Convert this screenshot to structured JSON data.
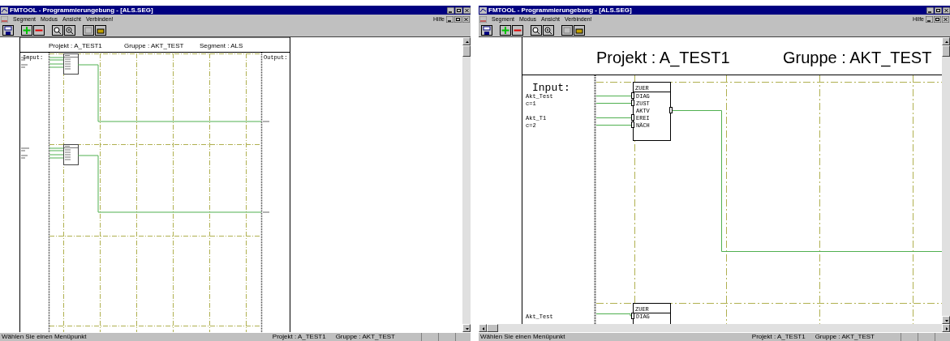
{
  "windows": [
    {
      "kind": "overview",
      "title": "FMTOOL - Programmierungebung - [ALS.SEG]",
      "menu": [
        "Segment",
        "Modus",
        "Ansicht",
        "Verbinden!"
      ],
      "help": "Hilfe",
      "header": [
        "Projekt : A_TEST1",
        "Gruppe : AKT_TEST",
        "Segment : ALS"
      ],
      "input_label": "Input:",
      "output_label": "Output:",
      "status": {
        "message": "Wählen Sie einen Menüpunkt",
        "project": "Projekt : A_TEST1",
        "group": "Gruppe : AKT_TEST"
      }
    },
    {
      "kind": "zoomed",
      "title": "FMTOOL - Programmierungebung - [ALS.SEG]",
      "menu": [
        "Segment",
        "Modus",
        "Ansicht",
        "Verbinden!"
      ],
      "help": "Hilfe",
      "header": [
        "Projekt : A_TEST1",
        "Gruppe : AKT_TEST"
      ],
      "input_label": "Input:",
      "inputs": [
        {
          "name": "Akt_Test",
          "value": "c=1"
        },
        {
          "name": "Akt_T1",
          "value": "c=2"
        },
        {
          "name": "Akt_Test"
        }
      ],
      "blocks": [
        {
          "title": "ZUER",
          "pins": [
            {
              "label": "DIAG",
              "kind": "input"
            },
            {
              "label": "ZUST",
              "kind": "input"
            },
            {
              "label": "AKTV",
              "kind": "output"
            },
            {
              "label": "EREI",
              "kind": "input"
            },
            {
              "label": "NÄCH",
              "kind": "input"
            }
          ]
        },
        {
          "title": "ZUER",
          "pins": [
            {
              "label": "DIAG",
              "kind": "input"
            }
          ]
        }
      ],
      "status": {
        "message": "Wählen Sie einen Menüpunkt",
        "project": "Projekt : A_TEST1",
        "group": "Gruppe : AKT_TEST"
      }
    }
  ]
}
